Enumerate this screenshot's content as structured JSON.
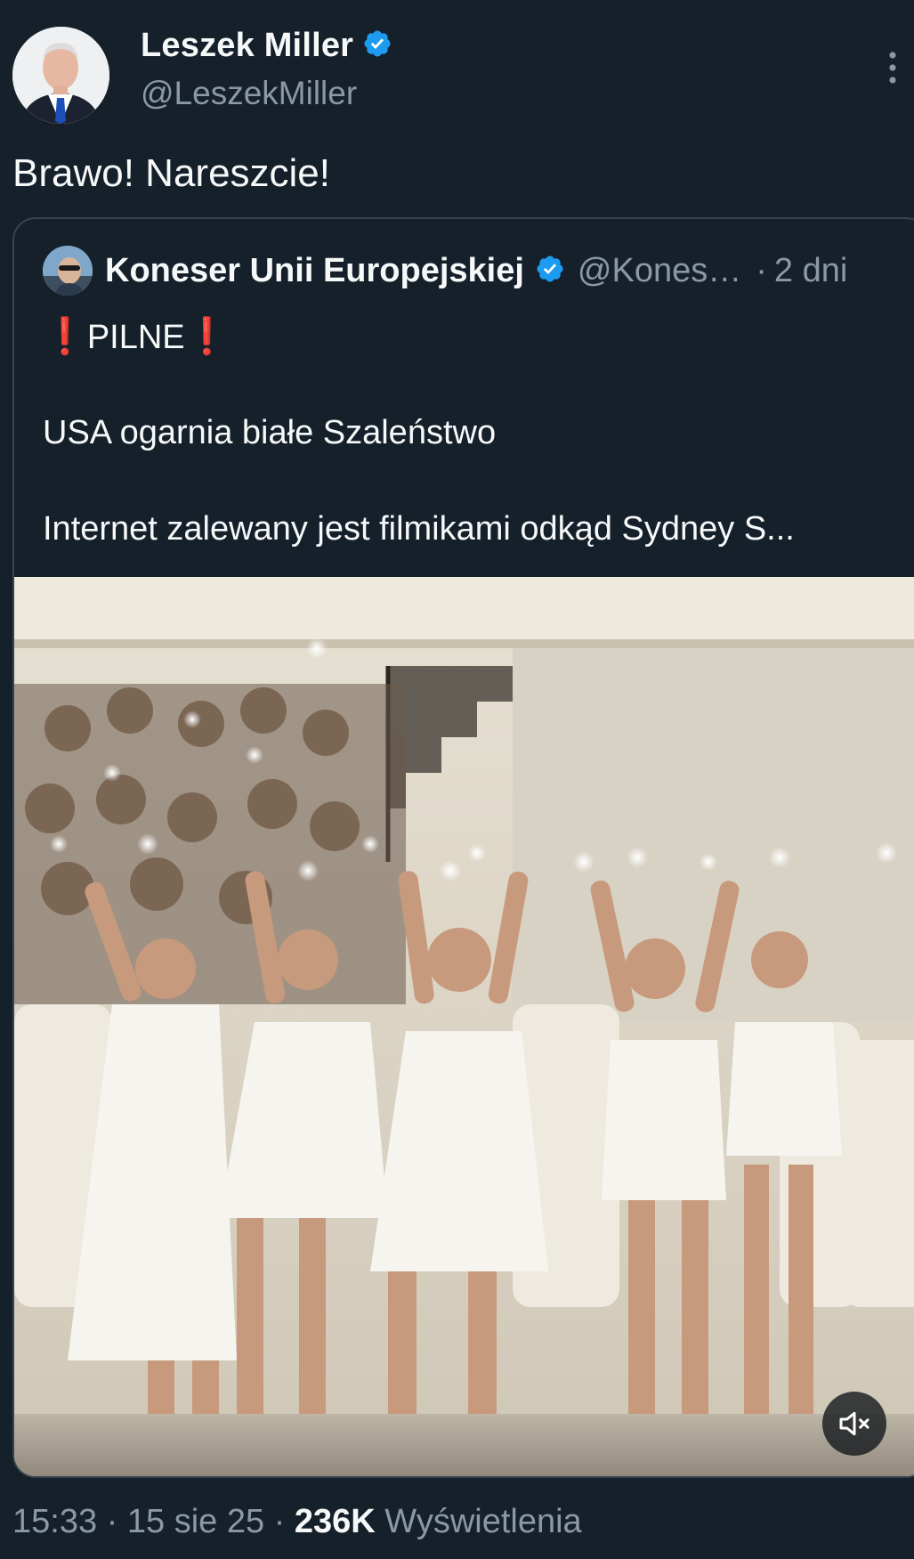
{
  "tweet": {
    "author": {
      "name": "Leszek Miller",
      "handle": "@LeszekMiller",
      "verified": true,
      "avatar_icon": "profile-photo-man-suit"
    },
    "text": "Brawo! Nareszcie!",
    "more_icon": "vertical-ellipsis-icon",
    "footer": {
      "time": "15:33",
      "sep1": "·",
      "date": "15 sie 25",
      "sep2": "·",
      "views_count": "236K",
      "views_label": "Wyświetlenia"
    }
  },
  "quoted": {
    "author": {
      "name": "Koneser Unii Europejskiej",
      "handle": "@Kones…",
      "verified": true,
      "avatar_icon": "profile-photo-sunglasses"
    },
    "dot": "·",
    "time": "2 dni",
    "lines": {
      "alarm_left": "❗",
      "headline": "PILNE",
      "alarm_right": "❗",
      "line2": "USA ogarnia białe Szaleństwo",
      "line3": "Internet zalewany jest filmikami odkąd Sydney S..."
    },
    "video": {
      "description_icon": "video-thumbnail-women-white-dresses",
      "mute_icon": "speaker-muted-icon"
    }
  },
  "colors": {
    "background": "#15202b",
    "text": "#f7f9f9",
    "muted": "#8b98a5",
    "verified": "#1d9bf0",
    "border": "#38444d",
    "alarm": "#e0243b"
  }
}
